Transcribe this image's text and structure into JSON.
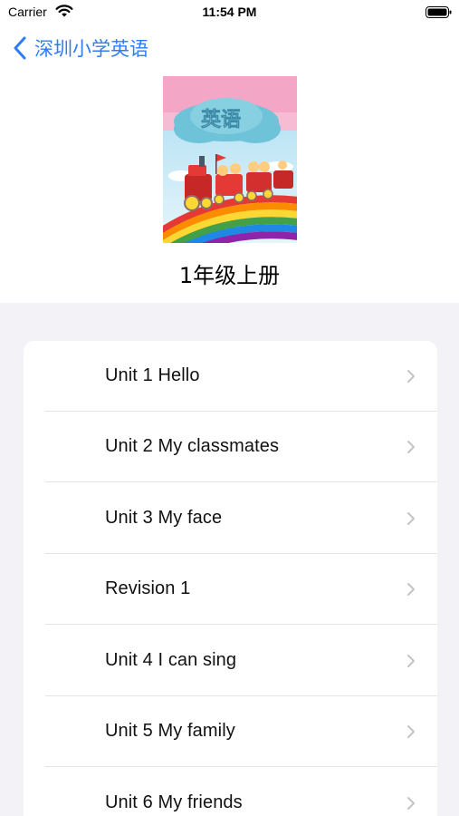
{
  "status": {
    "carrier": "Carrier",
    "time": "11:54 PM"
  },
  "nav": {
    "back_label": "深圳小学英语"
  },
  "book": {
    "title": "1年级上册",
    "cover_text": "英语"
  },
  "units": [
    {
      "label": "Unit 1 Hello"
    },
    {
      "label": "Unit 2 My classmates"
    },
    {
      "label": "Unit 3 My face"
    },
    {
      "label": "Revision 1"
    },
    {
      "label": "Unit 4 I can sing"
    },
    {
      "label": "Unit 5 My family"
    },
    {
      "label": "Unit 6 My friends"
    }
  ],
  "colors": {
    "accent": "#2f7cf6",
    "grouped_background": "#f2f2f7",
    "chevron": "#c4c4c7"
  }
}
